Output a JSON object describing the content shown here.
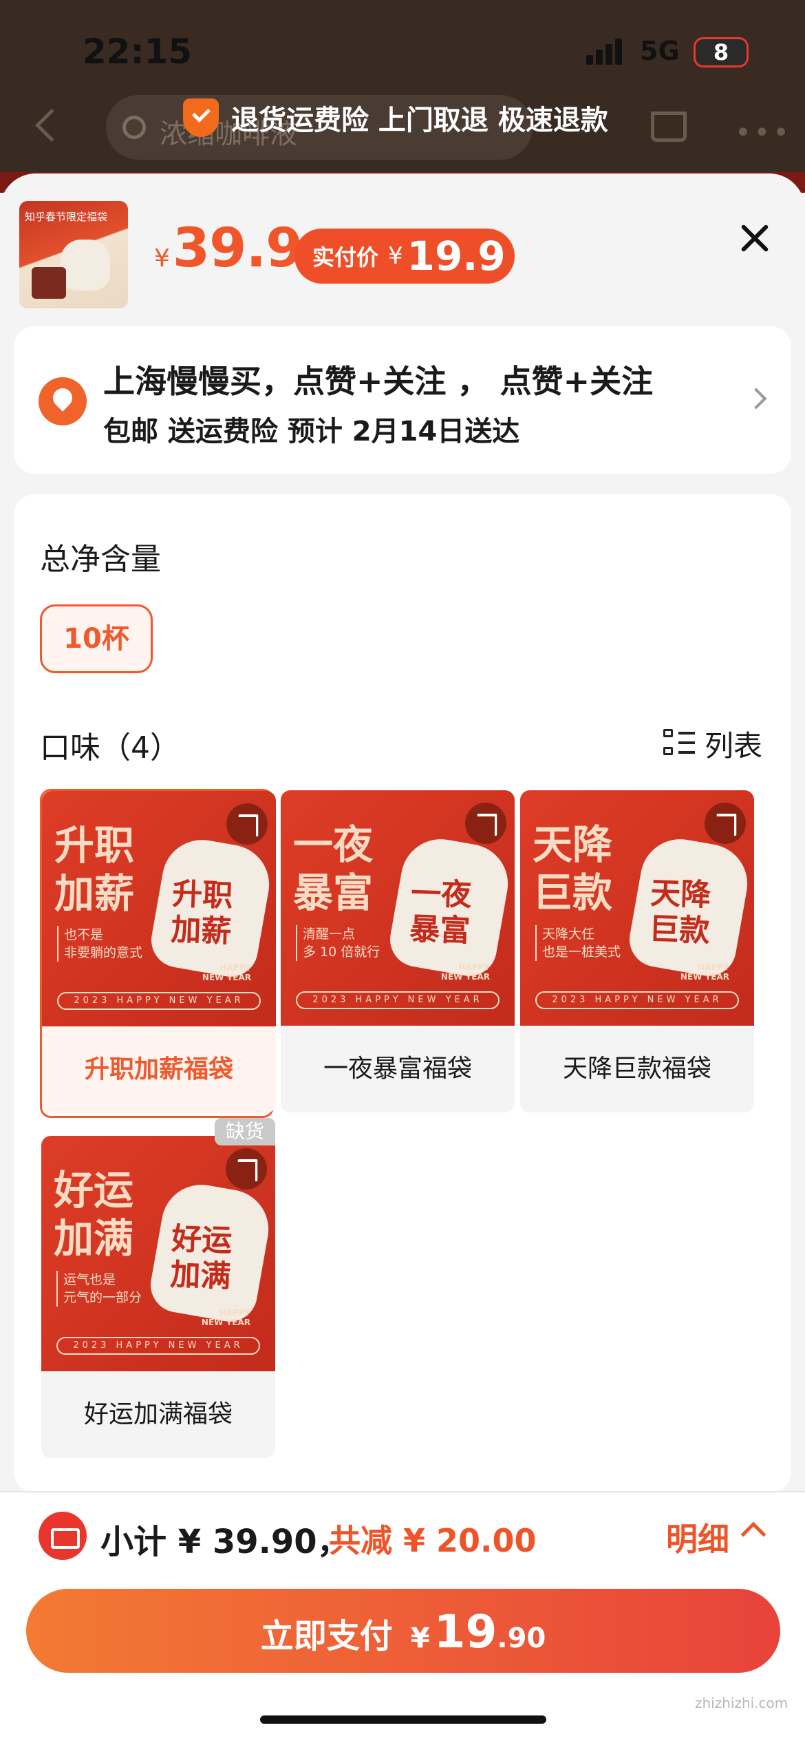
{
  "status_bar": {
    "time": "22:15",
    "network": "5G",
    "battery": "8"
  },
  "background": {
    "search_placeholder": "浓缩咖啡液"
  },
  "banner": {
    "text": "退货运费险 上门取退 极速退款"
  },
  "product": {
    "thumb_label": "知乎春节限定福袋",
    "currency": "¥",
    "price": "39.9",
    "actual_label": "实付价",
    "actual_currency": "¥",
    "actual_price": "19.9"
  },
  "address": {
    "line1": "上海慢慢买，点赞+关注 ， 点赞+关注",
    "line2": "包邮  送运费险  预计 2月14日送达"
  },
  "volume": {
    "title": "总净含量",
    "option": "10杯"
  },
  "flavor": {
    "title": "口味（4）",
    "view_toggle": "列表",
    "items": [
      {
        "label": "升职加薪福袋",
        "big": "升职\n加薪",
        "sub": "也不是\n非要躺的意式",
        "bag": "升职\n加薪",
        "selected": true
      },
      {
        "label": "一夜暴富福袋",
        "big": "一夜\n暴富",
        "sub": "清醒一点\n多 10 倍就行",
        "bag": "一夜\n暴富"
      },
      {
        "label": "天降巨款福袋",
        "big": "天降\n巨款",
        "sub": "天降大任\n也是一桩美式",
        "bag": "天降\n巨款"
      },
      {
        "label": "好运加满福袋",
        "big": "好运\n加满",
        "sub": "运气也是\n元气的一部分",
        "bag": "好运\n加满",
        "badge": "缺货"
      }
    ],
    "tile_footer": "2023  HAPPY NEW YEAR",
    "tile_happy": "HAPPY\nNEW YEAR"
  },
  "footer": {
    "subtotal": "小计 ¥ 39.90，",
    "discount": "共减 ¥ 20.00",
    "detail": "明细",
    "pay_label": "立即支付",
    "pay_currency": "¥",
    "pay_int": "19",
    "pay_dec": ".90"
  },
  "watermark": "zhizhizhi.com",
  "colors": {
    "accent": "#ee5a2b",
    "tile_red": "#d63a25"
  }
}
